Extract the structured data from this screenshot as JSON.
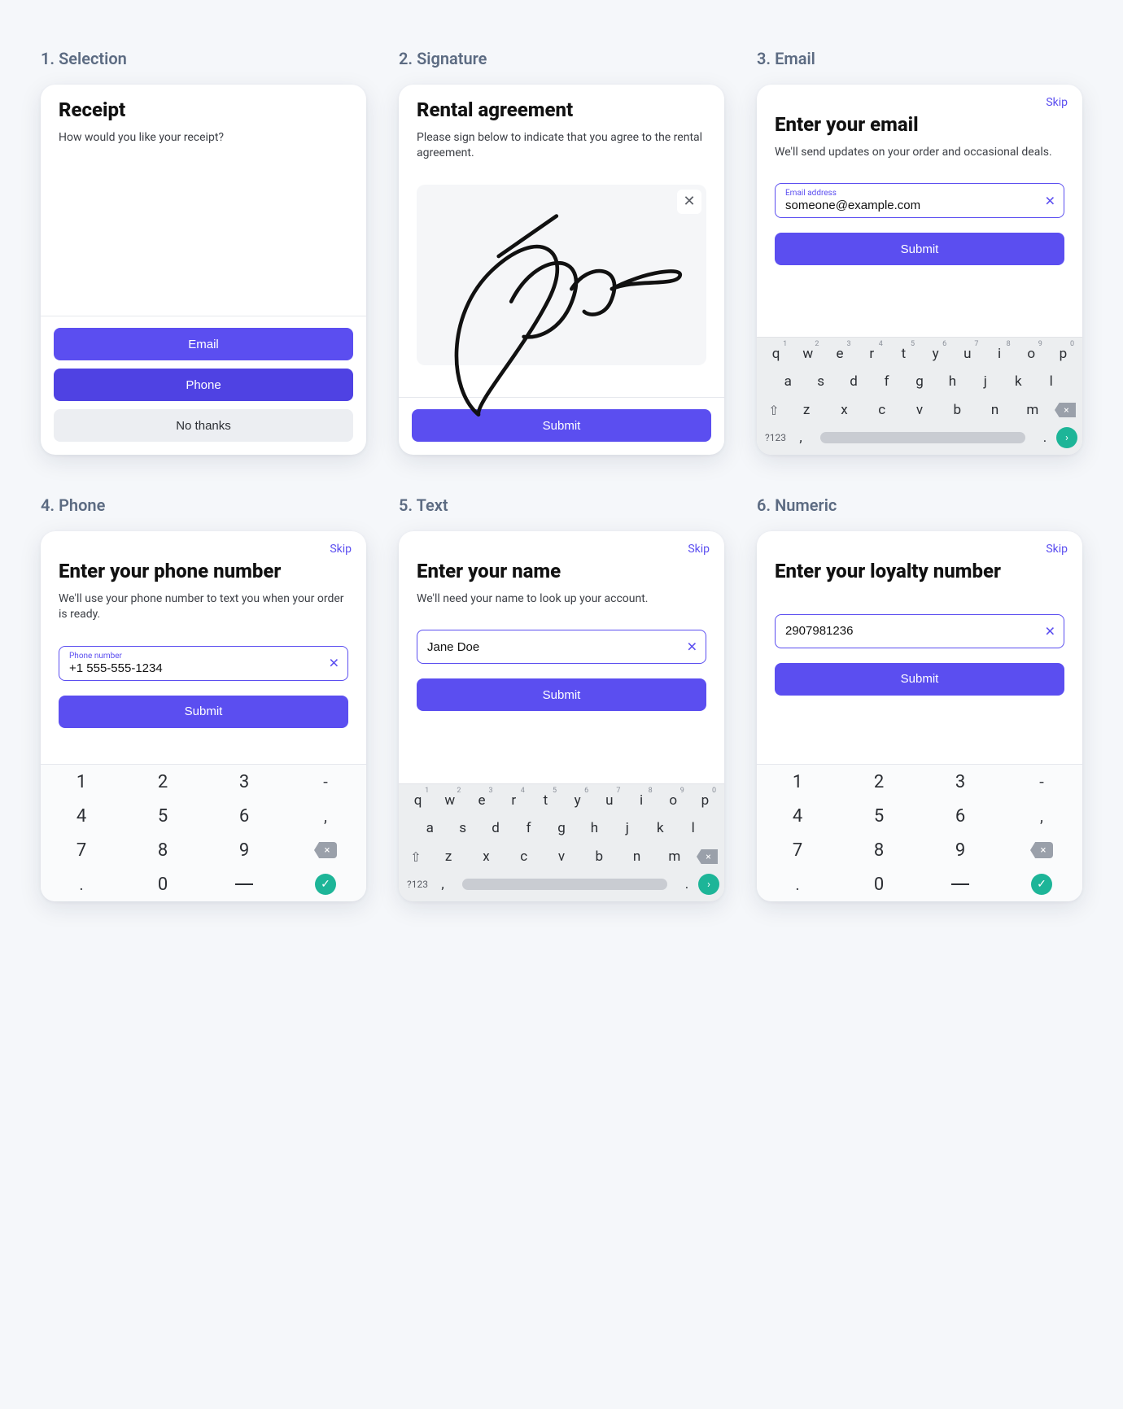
{
  "sections": {
    "selection": {
      "label": "1. Selection"
    },
    "signature": {
      "label": "2. Signature"
    },
    "email": {
      "label": "3. Email"
    },
    "phone": {
      "label": "4. Phone"
    },
    "text": {
      "label": "5. Text"
    },
    "numeric": {
      "label": "6. Numeric"
    }
  },
  "common": {
    "skip": "Skip",
    "submit": "Submit"
  },
  "receipt": {
    "title": "Receipt",
    "subtitle": "How would you like your receipt?",
    "options": {
      "email": "Email",
      "phone": "Phone",
      "none": "No thanks"
    }
  },
  "rental": {
    "title": "Rental agreement",
    "subtitle": "Please sign below to indicate that you agree to the rental agreement."
  },
  "email": {
    "title": "Enter your email",
    "subtitle": "We'll send updates on your order and occasional deals.",
    "field_label": "Email address",
    "value": "someone@example.com"
  },
  "phone": {
    "title": "Enter your phone number",
    "subtitle": "We'll use your phone number to text you when your order is ready.",
    "field_label": "Phone number",
    "value": "+1 555-555-1234"
  },
  "name": {
    "title": "Enter your name",
    "subtitle": "We'll need your name to look up your account.",
    "value": "Jane Doe"
  },
  "loyalty": {
    "title": "Enter your loyalty number",
    "value": "2907981236"
  },
  "qwerty": {
    "row1": [
      "q",
      "w",
      "e",
      "r",
      "t",
      "y",
      "u",
      "i",
      "o",
      "p"
    ],
    "sup1": [
      "1",
      "2",
      "3",
      "4",
      "5",
      "6",
      "7",
      "8",
      "9",
      "0"
    ],
    "row2": [
      "a",
      "s",
      "d",
      "f",
      "g",
      "h",
      "j",
      "k",
      "l"
    ],
    "row3": [
      "z",
      "x",
      "c",
      "v",
      "b",
      "n",
      "m"
    ],
    "alt_label": "?123",
    "comma": ",",
    "period": "."
  },
  "numpad": {
    "rows": [
      [
        "1",
        "2",
        "3",
        "-"
      ],
      [
        "4",
        "5",
        "6",
        ","
      ],
      [
        "7",
        "8",
        "9",
        "bksp"
      ],
      [
        ".",
        "0",
        "_",
        "go"
      ]
    ]
  }
}
